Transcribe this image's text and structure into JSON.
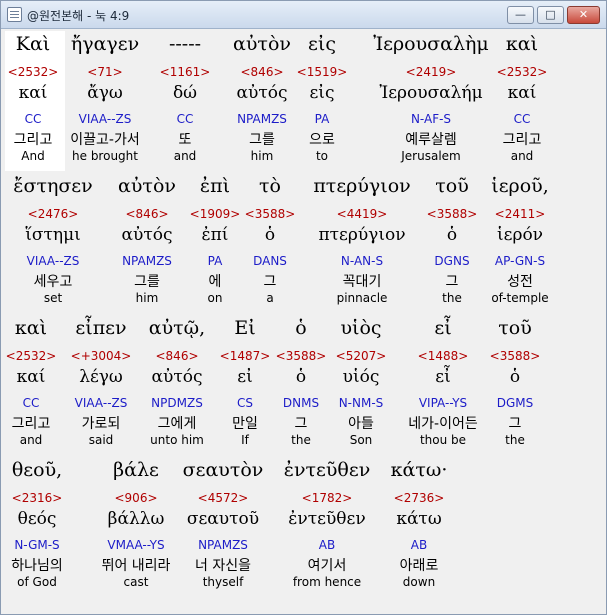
{
  "window": {
    "title": "@원전본해 - 눅 4:9"
  },
  "controls": {
    "minimize": "—",
    "maximize": "□",
    "close": "✕"
  },
  "rows": [
    {
      "words": [
        {
          "greek": "Καὶ",
          "strong": "<2532>",
          "lemma": "καί",
          "parse": "CC",
          "korean": "그리고",
          "english": "And"
        },
        {
          "greek": "ἤγαγεν",
          "strong": "<71>",
          "lemma": "ἄγω",
          "parse": "VIAA--ZS",
          "korean": "이끌고-가서",
          "english": "he brought"
        },
        {
          "greek": "-----",
          "strong": "<1161>",
          "lemma": "δώ",
          "parse": "CC",
          "korean": "또",
          "english": "and"
        },
        {
          "greek": "αὐτὸν",
          "strong": "<846>",
          "lemma": "αὐτός",
          "parse": "NPAMZS",
          "korean": "그를",
          "english": "him"
        },
        {
          "greek": "εἰς",
          "strong": "<1519>",
          "lemma": "εἰς",
          "parse": "PA",
          "korean": "으로",
          "english": "to"
        },
        {
          "greek": "Ἰερουσαλὴμ",
          "strong": "<2419>",
          "lemma": "Ἰερουσαλήμ",
          "parse": "N-AF-S",
          "korean": "예루살렘",
          "english": "Jerusalem"
        },
        {
          "greek": "καὶ",
          "strong": "<2532>",
          "lemma": "καί",
          "parse": "CC",
          "korean": "그리고",
          "english": "and"
        }
      ]
    },
    {
      "words": [
        {
          "greek": "ἔστησεν",
          "strong": "<2476>",
          "lemma": "ἵστημι",
          "parse": "VIAA--ZS",
          "korean": "세우고",
          "english": "set"
        },
        {
          "greek": "αὐτὸν",
          "strong": "<846>",
          "lemma": "αὐτός",
          "parse": "NPAMZS",
          "korean": "그를",
          "english": "him"
        },
        {
          "greek": "ἐπὶ",
          "strong": "<1909>",
          "lemma": "ἐπί",
          "parse": "PA",
          "korean": "에",
          "english": "on"
        },
        {
          "greek": "τὸ",
          "strong": "<3588>",
          "lemma": "ὁ",
          "parse": "DANS",
          "korean": "그",
          "english": "a"
        },
        {
          "greek": "πτερύγιον",
          "strong": "<4419>",
          "lemma": "πτερύγιον",
          "parse": "N-AN-S",
          "korean": "꼭대기",
          "english": "pinnacle"
        },
        {
          "greek": "τοῦ",
          "strong": "<3588>",
          "lemma": "ὁ",
          "parse": "DGNS",
          "korean": "그",
          "english": "the"
        },
        {
          "greek": "ἱεροῦ,",
          "strong": "<2411>",
          "lemma": "ἱερόν",
          "parse": "AP-GN-S",
          "korean": "성전",
          "english": "of-temple"
        }
      ]
    },
    {
      "words": [
        {
          "greek": "καὶ",
          "strong": "<2532>",
          "lemma": "καί",
          "parse": "CC",
          "korean": "그리고",
          "english": "and"
        },
        {
          "greek": "εἶπεν",
          "strong": "<+3004>",
          "lemma": "λέγω",
          "parse": "VIAA--ZS",
          "korean": "가로되",
          "english": "said"
        },
        {
          "greek": "αὐτῷ,",
          "strong": "<846>",
          "lemma": "αὐτός",
          "parse": "NPDMZS",
          "korean": "그에게",
          "english": "unto him"
        },
        {
          "greek": "Εἰ",
          "strong": "<1487>",
          "lemma": "εἰ",
          "parse": "CS",
          "korean": "만일",
          "english": "If"
        },
        {
          "greek": "ὁ",
          "strong": "<3588>",
          "lemma": "ὁ",
          "parse": "DNMS",
          "korean": "그",
          "english": "the"
        },
        {
          "greek": "υἱὸς",
          "strong": "<5207>",
          "lemma": "υἱός",
          "parse": "N-NM-S",
          "korean": "아들",
          "english": "Son"
        },
        {
          "greek": "εἶ",
          "strong": "<1488>",
          "lemma": "εἶ",
          "parse": "VIPA--YS",
          "korean": "네가-이어든",
          "english": "thou be"
        },
        {
          "greek": "τοῦ",
          "strong": "<3588>",
          "lemma": "ὁ",
          "parse": "DGMS",
          "korean": "그",
          "english": "the"
        }
      ]
    },
    {
      "words": [
        {
          "greek": "θεοῦ,",
          "strong": "<2316>",
          "lemma": "θεός",
          "parse": "N-GM-S",
          "korean": "하나님의",
          "english": "of God"
        },
        {
          "greek": "βάλε",
          "strong": "<906>",
          "lemma": "βάλλω",
          "parse": "VMAA--YS",
          "korean": "뛰어 내리라",
          "english": "cast"
        },
        {
          "greek": "σεαυτὸν",
          "strong": "<4572>",
          "lemma": "σεαυτοῦ",
          "parse": "NPAMZS",
          "korean": "너 자신을",
          "english": "thyself"
        },
        {
          "greek": "ἐντεῦθεν",
          "strong": "<1782>",
          "lemma": "ἐντεῦθεν",
          "parse": "AB",
          "korean": "여기서",
          "english": "from hence"
        },
        {
          "greek": "κάτω·",
          "strong": "<2736>",
          "lemma": "κάτω",
          "parse": "AB",
          "korean": "아래로",
          "english": "down"
        }
      ]
    }
  ]
}
